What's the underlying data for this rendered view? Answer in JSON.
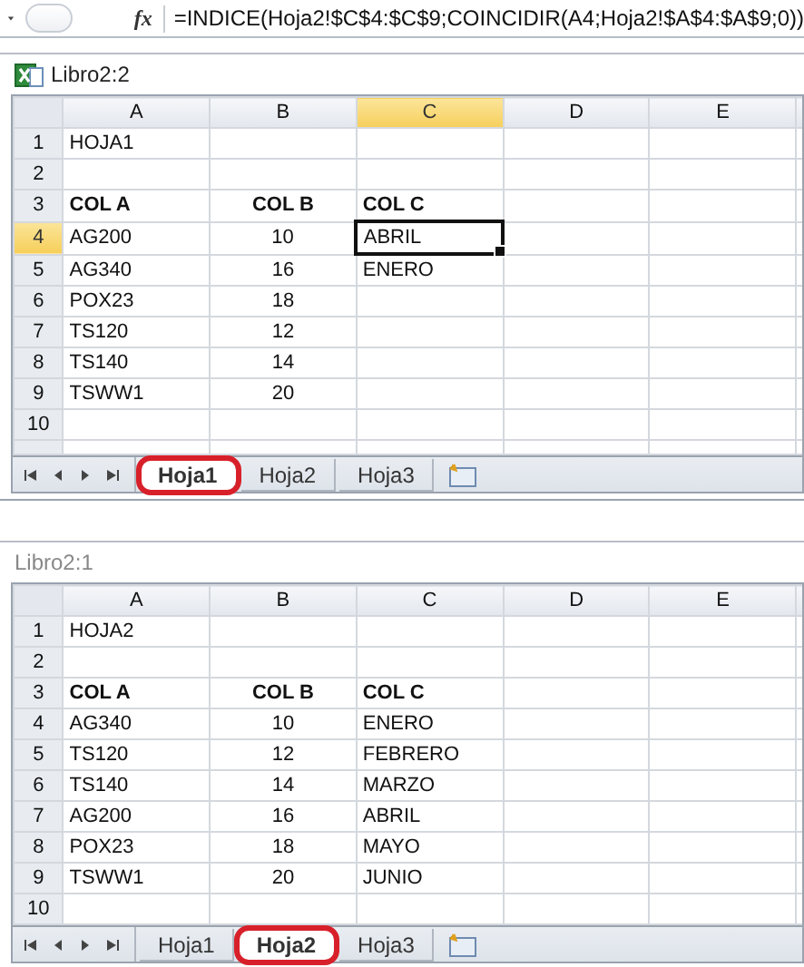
{
  "formula_bar": {
    "function_label": "fx",
    "formula": "=INDICE(Hoja2!$C$4:$C$9;COINCIDIR(A4;Hoja2!$A$4:$A$9;0))"
  },
  "windows": [
    {
      "title": "Libro2:2",
      "active": true,
      "columns": [
        {
          "label": "A",
          "selected": false
        },
        {
          "label": "B",
          "selected": false
        },
        {
          "label": "C",
          "selected": true
        },
        {
          "label": "D",
          "selected": false
        },
        {
          "label": "E",
          "selected": false
        }
      ],
      "rows": [
        {
          "number": "1",
          "selected": false,
          "bold": false,
          "cells": [
            "HOJA1",
            "",
            "",
            "",
            ""
          ]
        },
        {
          "number": "2",
          "selected": false
        },
        {
          "number": "3",
          "selected": false,
          "bold": true,
          "cells": [
            "COL A",
            "COL B",
            "COL C",
            "",
            ""
          ]
        },
        {
          "number": "4",
          "selected": true,
          "bold": false,
          "cells": [
            {
              "text": "AG200",
              "active": false
            },
            {
              "text": "10",
              "active": false
            },
            {
              "text": "ABRIL",
              "active": true
            },
            {
              "text": "",
              "active": false
            },
            {
              "text": "",
              "active": false
            }
          ]
        },
        {
          "number": "5",
          "selected": false,
          "bold": false,
          "cells": [
            "AG340",
            "16",
            "ENERO",
            "",
            ""
          ]
        },
        {
          "number": "6",
          "selected": false,
          "bold": false,
          "cells": [
            "POX23",
            "18",
            "",
            "",
            ""
          ]
        },
        {
          "number": "7",
          "selected": false,
          "bold": false,
          "cells": [
            "TS120",
            "12",
            "",
            "",
            ""
          ]
        },
        {
          "number": "8",
          "selected": false,
          "bold": false,
          "cells": [
            "TS140",
            "14",
            "",
            "",
            ""
          ]
        },
        {
          "number": "9",
          "selected": false,
          "bold": false,
          "cells": [
            "TSWW1",
            "20",
            "",
            "",
            ""
          ]
        },
        {
          "number": "10",
          "selected": false
        }
      ],
      "partial_row": true,
      "tabs": [
        {
          "label": "Hoja1",
          "selected": true,
          "circled": true
        },
        {
          "label": "Hoja2",
          "selected": false,
          "circled": false
        },
        {
          "label": "Hoja3",
          "selected": false,
          "circled": false
        }
      ]
    },
    {
      "title": "Libro2:1",
      "active": false,
      "columns": [
        {
          "label": "A",
          "selected": false
        },
        {
          "label": "B",
          "selected": false
        },
        {
          "label": "C",
          "selected": false
        },
        {
          "label": "D",
          "selected": false
        },
        {
          "label": "E",
          "selected": false
        }
      ],
      "rows": [
        {
          "number": "1",
          "selected": false,
          "bold": false,
          "cells": [
            "HOJA2",
            "",
            "",
            "",
            ""
          ]
        },
        {
          "number": "2",
          "selected": false
        },
        {
          "number": "3",
          "selected": false,
          "bold": true,
          "cells": [
            "COL A",
            "COL B",
            "COL C",
            "",
            ""
          ]
        },
        {
          "number": "4",
          "selected": false,
          "bold": false,
          "cells": [
            "AG340",
            "10",
            "ENERO",
            "",
            ""
          ]
        },
        {
          "number": "5",
          "selected": false,
          "bold": false,
          "cells": [
            "TS120",
            "12",
            "FEBRERO",
            "",
            ""
          ]
        },
        {
          "number": "6",
          "selected": false,
          "bold": false,
          "cells": [
            "TS140",
            "14",
            "MARZO",
            "",
            ""
          ]
        },
        {
          "number": "7",
          "selected": false,
          "bold": false,
          "cells": [
            "AG200",
            "16",
            "ABRIL",
            "",
            ""
          ]
        },
        {
          "number": "8",
          "selected": false,
          "bold": false,
          "cells": [
            "POX23",
            "18",
            "MAYO",
            "",
            ""
          ]
        },
        {
          "number": "9",
          "selected": false,
          "bold": false,
          "cells": [
            "TSWW1",
            "20",
            "JUNIO",
            "",
            ""
          ]
        },
        {
          "number": "10",
          "selected": false
        }
      ],
      "partial_row": false,
      "tabs": [
        {
          "label": "Hoja1",
          "selected": false,
          "circled": false
        },
        {
          "label": "Hoja2",
          "selected": true,
          "circled": true
        },
        {
          "label": "Hoja3",
          "selected": false,
          "circled": false
        }
      ]
    }
  ]
}
